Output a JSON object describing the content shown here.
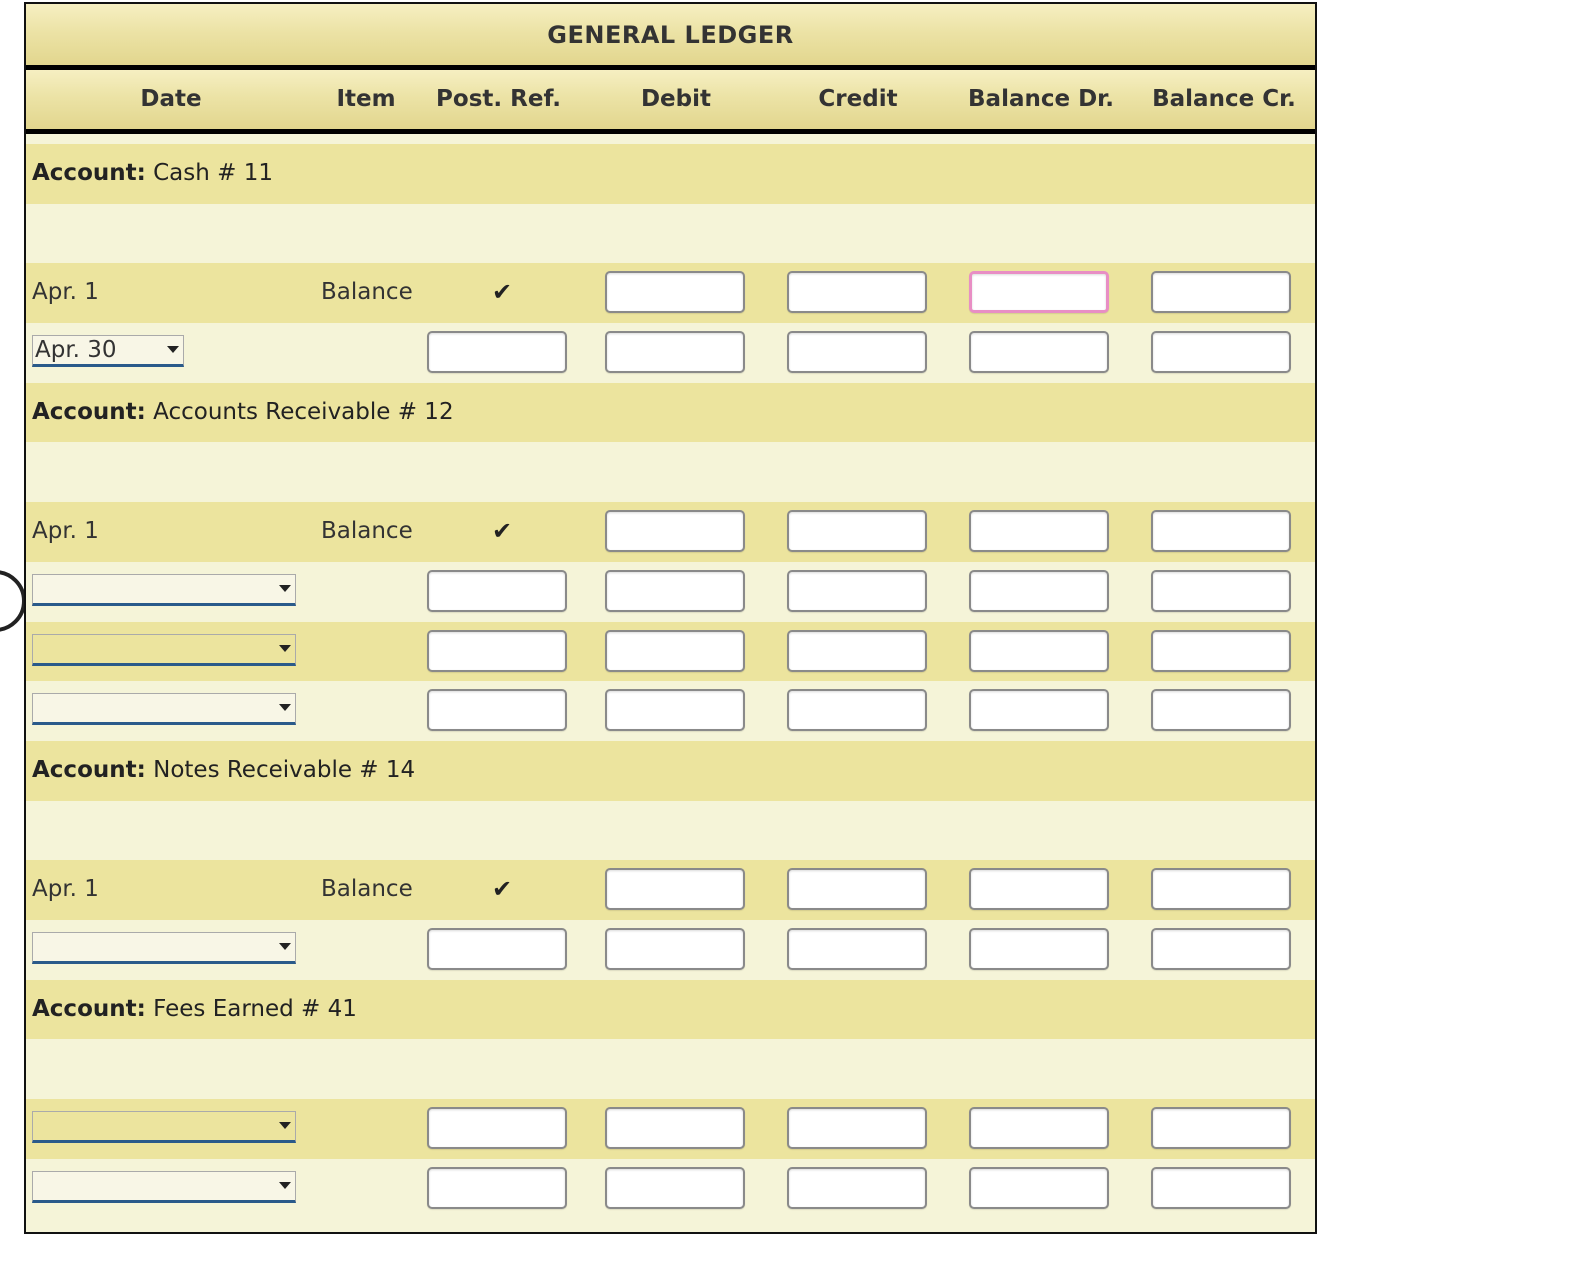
{
  "title": "GENERAL LEDGER",
  "columns": {
    "date": "Date",
    "item": "Item",
    "post_ref": "Post. Ref.",
    "debit": "Debit",
    "credit": "Credit",
    "balance_dr": "Balance Dr.",
    "balance_cr": "Balance Cr."
  },
  "account_label": "Account:",
  "accounts": [
    {
      "name": "Cash # 11",
      "opening": {
        "date": "Apr. 1",
        "item": "Balance",
        "post_ref": "✔"
      },
      "entry_dates": [
        "Apr. 30"
      ]
    },
    {
      "name": "Accounts Receivable # 12",
      "opening": {
        "date": "Apr. 1",
        "item": "Balance",
        "post_ref": "✔"
      },
      "entry_dates": [
        "",
        "",
        ""
      ]
    },
    {
      "name": "Notes Receivable # 14",
      "opening": {
        "date": "Apr. 1",
        "item": "Balance",
        "post_ref": "✔"
      },
      "entry_dates": [
        ""
      ]
    },
    {
      "name": "Fees Earned # 41",
      "opening": null,
      "entry_dates": [
        "",
        ""
      ]
    }
  ],
  "colors": {
    "header_band": "#ece3a6",
    "row_dark": "#ece49e",
    "row_light": "#f5f4d8",
    "focus_border": "#e88ec4",
    "select_underline": "#2a5a8a"
  },
  "icons": {
    "post_ref": "checkmark-icon",
    "dropdown": "chevron-down-icon"
  }
}
